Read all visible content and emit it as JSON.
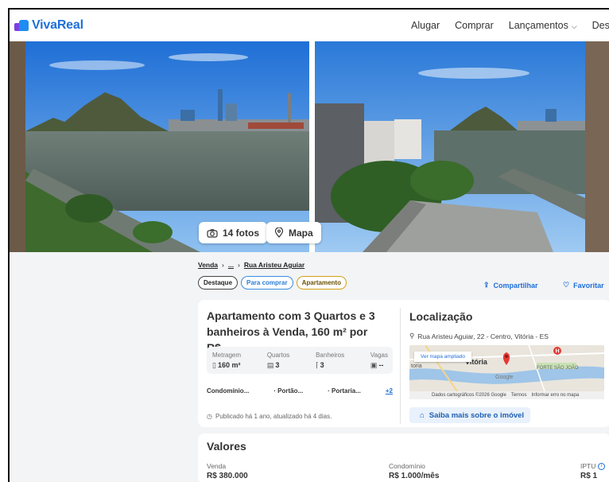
{
  "header": {
    "logo": "VivaReal",
    "nav": [
      {
        "label": "Alugar"
      },
      {
        "label": "Comprar"
      },
      {
        "label": "Lançamentos"
      },
      {
        "label": "Desc"
      }
    ]
  },
  "gallery": {
    "photos_button": "14 fotos",
    "map_button": "Mapa"
  },
  "breadcrumb": [
    "Venda",
    "...",
    "Rua Aristeu Aguiar"
  ],
  "tags": [
    "Destaque",
    "Para comprar",
    "Apartamento"
  ],
  "actions": {
    "share": "Compartilhar",
    "favorite": "Favoritar"
  },
  "listing": {
    "title": "Apartamento com 3 Quartos e 3 banheiros à Venda, 160 m² por R$...",
    "specs": [
      {
        "label": "Metragem",
        "value": "160 m²",
        "icon": "ruler-icon"
      },
      {
        "label": "Quartos",
        "value": "3",
        "icon": "bed-icon"
      },
      {
        "label": "Banheiros",
        "value": "3",
        "icon": "shower-icon"
      },
      {
        "label": "Vagas",
        "value": "--",
        "icon": "car-icon"
      }
    ],
    "amenities": [
      "Condomínio...",
      "Portão...",
      "Portaria..."
    ],
    "amenities_more": "+2",
    "published": "Publicado há 1 ano, atualizado há 4 dias."
  },
  "location": {
    "title": "Localização",
    "address": "Rua Aristeu Aguiar, 22 - Centro, Vitória - ES",
    "map_link": "Ver mapa ampliado",
    "map_labels": {
      "city": "Vitória",
      "forte": "FORTE SÃO JOÃO",
      "left": "toria",
      "google": "Google"
    },
    "map_footer": [
      "Dados cartográficos ©2026 Google",
      "Termos",
      "Informar erro no mapa"
    ],
    "more_button": "Saiba mais sobre o imóvel"
  },
  "valores": {
    "title": "Valores",
    "items": [
      {
        "label": "Venda",
        "value": "R$ 380.000"
      },
      {
        "label": "Condomínio",
        "value": "R$ 1.000/mês"
      },
      {
        "label": "IPTU",
        "value": "R$ 1"
      }
    ]
  },
  "colors": {
    "brand": "#1e6fd9",
    "tag_blue": "#3a8de0",
    "tag_gold": "#d4a017",
    "pin": "#e53935"
  }
}
